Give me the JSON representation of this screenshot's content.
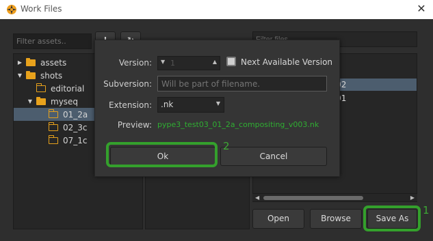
{
  "window": {
    "title": "Work Files",
    "app_icon": "nuke-logo-icon",
    "close_icon": "close-icon"
  },
  "left": {
    "filter_placeholder": "Filter assets..",
    "tool_buttons": [
      {
        "icon": "bold-glyph-icon",
        "glyph": "!"
      },
      {
        "icon": "refresh-icon",
        "glyph": "↻"
      }
    ],
    "tree": [
      {
        "label": "assets",
        "arrow": "▶",
        "folder": "filled",
        "depth": 0,
        "selected": false
      },
      {
        "label": "shots",
        "arrow": "▼",
        "folder": "filled",
        "depth": 0,
        "selected": false
      },
      {
        "label": "editorial",
        "arrow": "",
        "folder": "outline",
        "depth": 1,
        "selected": false
      },
      {
        "label": "myseq",
        "arrow": "▼",
        "folder": "filled",
        "depth": 1,
        "selected": false
      },
      {
        "label": "01_2a",
        "arrow": "",
        "folder": "outline",
        "depth": 2,
        "selected": true
      },
      {
        "label": "02_3c",
        "arrow": "",
        "folder": "outline",
        "depth": 2,
        "selected": false
      },
      {
        "label": "07_1c",
        "arrow": "",
        "folder": "outline",
        "depth": 2,
        "selected": false
      }
    ]
  },
  "right": {
    "filter_placeholder": "Filter files",
    "files": [
      {
        "label": "2a_compositing_v002",
        "selected": true
      },
      {
        "label": "2a_compositing_v001",
        "selected": false
      }
    ],
    "buttons": {
      "open": "Open",
      "browse": "Browse",
      "save_as": "Save As"
    },
    "callout_save_as": "1"
  },
  "dialog": {
    "version_label": "Version:",
    "version_value": "1",
    "next_available_label": "Next Available Version",
    "next_available_checked": true,
    "subversion_label": "Subversion:",
    "subversion_placeholder": "Will be part of filename.",
    "extension_label": "Extension:",
    "extension_value": ".nk",
    "preview_label": "Preview:",
    "preview_value": "pype3_test03_01_2a_compositing_v003.nk",
    "ok_label": "Ok",
    "cancel_label": "Cancel",
    "callout_ok": "2"
  },
  "colors": {
    "highlight": "#34a02c",
    "preview_text": "#2fae32",
    "folder": "#e8a21c",
    "selection": "#4c5d6e"
  }
}
